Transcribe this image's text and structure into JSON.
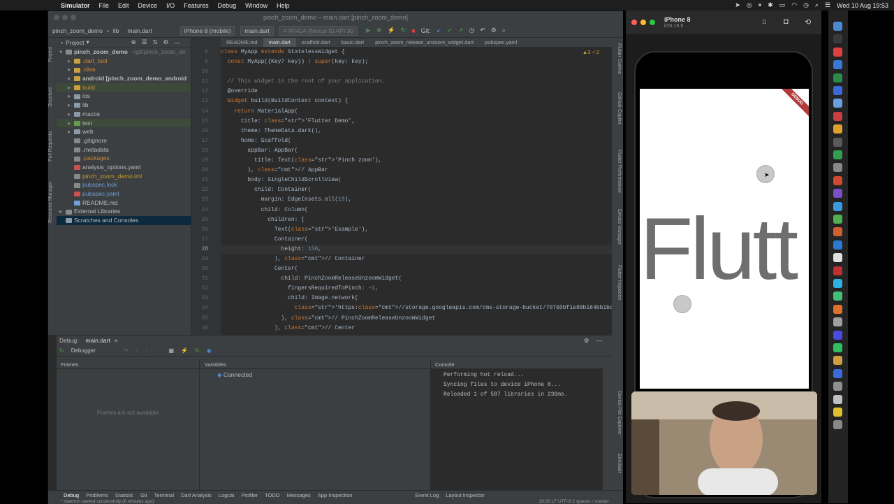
{
  "menubar": {
    "app": "Simulator",
    "items": [
      "File",
      "Edit",
      "Device",
      "I/O",
      "Features",
      "Debug",
      "Window",
      "Help"
    ],
    "clock": "Wed 10 Aug  19:53"
  },
  "ide": {
    "title": "pinch_zoom_demo – main.dart [pinch_zoom_demo]",
    "breadcrumb": [
      "pinch_zoom_demo",
      "lib",
      "main.dart"
    ],
    "device": "iPhone 8 (mobile)",
    "run_config": "main.dart",
    "emulator": "4 WVGA (Nexus S) API 30",
    "git_label": "Git:",
    "project_label": "Project",
    "tree": [
      {
        "label": "pinch_zoom_demo",
        "extra": "~/git/pinch_zoom_de",
        "depth": 0,
        "arrow": "▾",
        "color": "#8c8c8c",
        "bold": true
      },
      {
        "label": ".dart_tool",
        "depth": 1,
        "arrow": "▸",
        "color": "#c8a040",
        "text": "#c88a3a"
      },
      {
        "label": ".idea",
        "depth": 1,
        "arrow": "▸",
        "color": "#c8a040",
        "text": "#c88a3a"
      },
      {
        "label": "android [pinch_zoom_demo_android",
        "depth": 1,
        "arrow": "▸",
        "color": "#c8a040",
        "bold": true
      },
      {
        "label": "build",
        "depth": 1,
        "arrow": "▸",
        "color": "#c8a040",
        "text": "#c88a3a",
        "hl": true
      },
      {
        "label": "ios",
        "depth": 1,
        "arrow": "▸",
        "color": "#8c9aa8"
      },
      {
        "label": "lib",
        "depth": 1,
        "arrow": "▸",
        "color": "#8c9aa8"
      },
      {
        "label": "macos",
        "depth": 1,
        "arrow": "▸",
        "color": "#8c9aa8"
      },
      {
        "label": "test",
        "depth": 1,
        "arrow": "▸",
        "color": "#6a9a50",
        "hl": true
      },
      {
        "label": "web",
        "depth": 1,
        "arrow": "▸",
        "color": "#8c9aa8"
      },
      {
        "label": ".gitignore",
        "depth": 1,
        "arrow": "",
        "color": "#888"
      },
      {
        "label": ".metadata",
        "depth": 1,
        "arrow": "",
        "color": "#888"
      },
      {
        "label": ".packages",
        "depth": 1,
        "arrow": "",
        "color": "#888",
        "text": "#c88a3a"
      },
      {
        "label": "analysis_options.yaml",
        "depth": 1,
        "arrow": "",
        "color": "#c85050"
      },
      {
        "label": "pinch_zoom_demo.iml",
        "depth": 1,
        "arrow": "",
        "color": "#888",
        "text": "#c8a030"
      },
      {
        "label": "pubspec.lock",
        "depth": 1,
        "arrow": "",
        "color": "#888",
        "text": "#6fa0d8"
      },
      {
        "label": "pubspec.yaml",
        "depth": 1,
        "arrow": "",
        "color": "#c85050",
        "text": "#6fa0d8"
      },
      {
        "label": "README.md",
        "depth": 1,
        "arrow": "",
        "color": "#6fa0d8"
      },
      {
        "label": "External Libraries",
        "depth": 0,
        "arrow": "▸",
        "color": "#8c8c8c"
      },
      {
        "label": "Scratches and Consoles",
        "depth": 0,
        "arrow": "",
        "color": "#8c9aa8",
        "sel": true
      }
    ],
    "tabs": [
      "README.md",
      "main.dart",
      "scaffold.dart",
      "basic.dart",
      "pinch_zoom_release_unzoom_widget.dart",
      "pubspec.yaml"
    ],
    "active_tab": 1,
    "warnings": "▲3  ✓2",
    "line_numbers": [
      "8",
      "9",
      "10",
      "11",
      "12",
      "13",
      "14",
      "15",
      "16",
      "17",
      "18",
      "19",
      "20",
      "21",
      "22",
      "23",
      "24",
      "25",
      "26",
      "27",
      "28",
      "29",
      "30",
      "31",
      "32",
      "33",
      "34",
      "35",
      "36"
    ],
    "code": [
      "class MyApp extends StatelessWidget {",
      "  const MyApp({Key? key}) : super(key: key);",
      "",
      "  // This widget is the root of your application.",
      "  @override",
      "  Widget build(BuildContext context) {",
      "    return MaterialApp(",
      "      title: 'Flutter Demo',",
      "      theme: ThemeData.dark(),",
      "      home: Scaffold(",
      "        appBar: AppBar(",
      "          title: Text('Pinch zoom'),",
      "        ), // AppBar",
      "        body: SingleChildScrollView(",
      "          child: Container(",
      "            margin: EdgeInsets.all(10),",
      "            child: Column(",
      "              children: [",
      "                Text('Example'),",
      "                Container(",
      "                  height: 150,",
      "                ), // Container",
      "                Center(",
      "                  child: PinchZoomReleaseUnzoomWidget(",
      "                    fingersRequiredToPinch: -1,",
      "                    child: Image.network(",
      "                      'https://storage.googleapis.com/cms-storage-bucket/70760bf1e88b184bb1bc.png'), // Image",
      "                  ), // PinchZoomReleaseUnzoomWidget",
      "                ), // Center"
    ],
    "debug": {
      "label": "Debug:",
      "config": "main.dart",
      "debugger_tab": "Debugger",
      "frames_title": "Frames",
      "frames_empty": "Frames are not available",
      "variables_title": "Variables",
      "variables": [
        "Connected"
      ],
      "console_title": "Console",
      "console_lines": [
        "Performing hot reload...",
        "Syncing files to device iPhone 8...",
        "Reloaded 1 of 587 libraries in 236ms."
      ]
    },
    "bottom_tabs": [
      "Debug",
      "Problems",
      "Statistic",
      "Git",
      "Terminal",
      "Dart Analysis",
      "Logcat",
      "Profiler",
      "TODO",
      "Messages",
      "App Inspection",
      "Event Log",
      "Layout Inspector"
    ],
    "status_left": "* daemon started successfully (8 minutes ago)",
    "status_right": "28:28   LF   UTF-8   2 spaces   ↑ master",
    "left_vtabs": [
      "Project",
      "Structure",
      "Pull Requests",
      "Resource Manager",
      "Favorites",
      "Build Variants"
    ],
    "right_vtabs": [
      "Flutter Outline",
      "GitHub Copilot",
      "Flutter Performance",
      "Device Manager",
      "Flutter Inspector",
      "Device File Explorer",
      "Emulator"
    ]
  },
  "simulator": {
    "device": "iPhone 8",
    "os": "iOS 15.5",
    "app_text": "Flutt",
    "debug_banner": "DEBUG"
  },
  "colors": {
    "ide_bg": "#2b2b2b",
    "panel": "#3c3f41",
    "keyword": "#cc7832",
    "string": "#6a8759",
    "comment": "#808080"
  }
}
